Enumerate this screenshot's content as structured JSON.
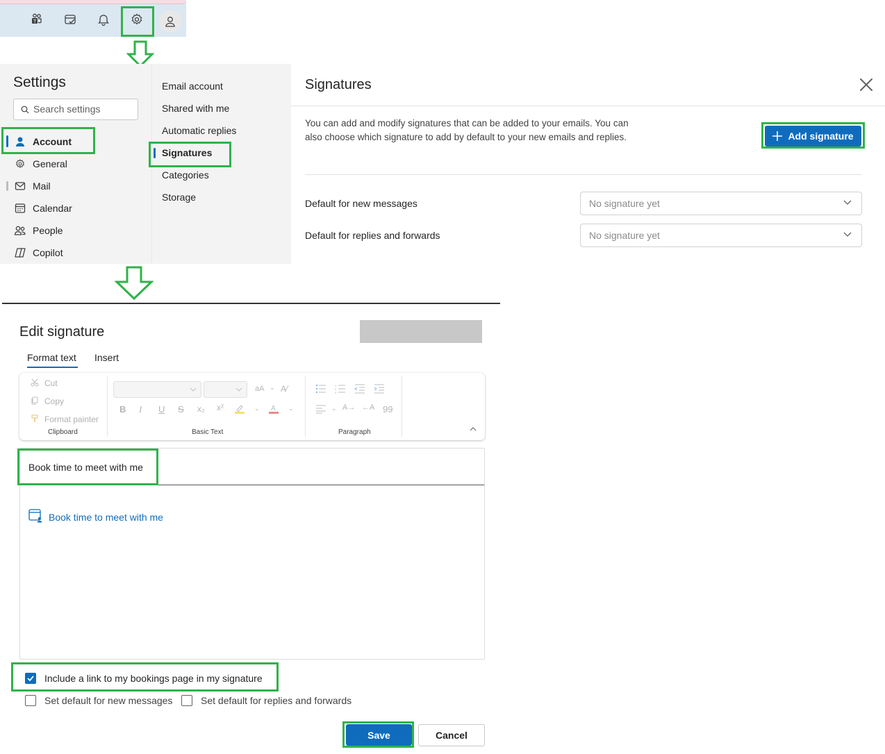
{
  "topbar": {
    "icons": [
      "teams-icon",
      "tasks-icon",
      "bell-icon",
      "gear-icon",
      "person-icon"
    ]
  },
  "settings": {
    "title": "Settings",
    "search_placeholder": "Search settings",
    "nav": [
      {
        "label": "Account",
        "icon": "person-icon"
      },
      {
        "label": "General",
        "icon": "gear-icon"
      },
      {
        "label": "Mail",
        "icon": "mail-icon"
      },
      {
        "label": "Calendar",
        "icon": "calendar-icon"
      },
      {
        "label": "People",
        "icon": "people-icon"
      },
      {
        "label": "Copilot",
        "icon": "copilot-icon"
      }
    ],
    "subnav": [
      "Email account",
      "Shared with me",
      "Automatic replies",
      "Signatures",
      "Categories",
      "Storage"
    ]
  },
  "signatures": {
    "title": "Signatures",
    "description": "You can add and modify signatures that can be added to your emails. You can also choose which signature to add by default to your new emails and replies.",
    "add_button": "Add signature",
    "default_new_label": "Default for new messages",
    "default_new_value": "No signature yet",
    "default_reply_label": "Default for replies and forwards",
    "default_reply_value": "No signature yet"
  },
  "edit": {
    "title": "Edit signature",
    "tabs": [
      "Format text",
      "Insert"
    ],
    "ribbon": {
      "clipboard": [
        "Cut",
        "Copy",
        "Format painter"
      ],
      "groups": [
        "Clipboard",
        "Basic Text",
        "Paragraph"
      ]
    },
    "signature_name": "Book time to meet with me",
    "booking_link": "Book time to meet with me",
    "include_link_label": "Include a link to my bookings page in my signature",
    "include_link_checked": true,
    "default_new_label": "Set default for new messages",
    "default_reply_label": "Set default for replies and forwards",
    "save": "Save",
    "cancel": "Cancel"
  },
  "colors": {
    "accent": "#0f6cbd",
    "highlight": "#2fb34a"
  }
}
